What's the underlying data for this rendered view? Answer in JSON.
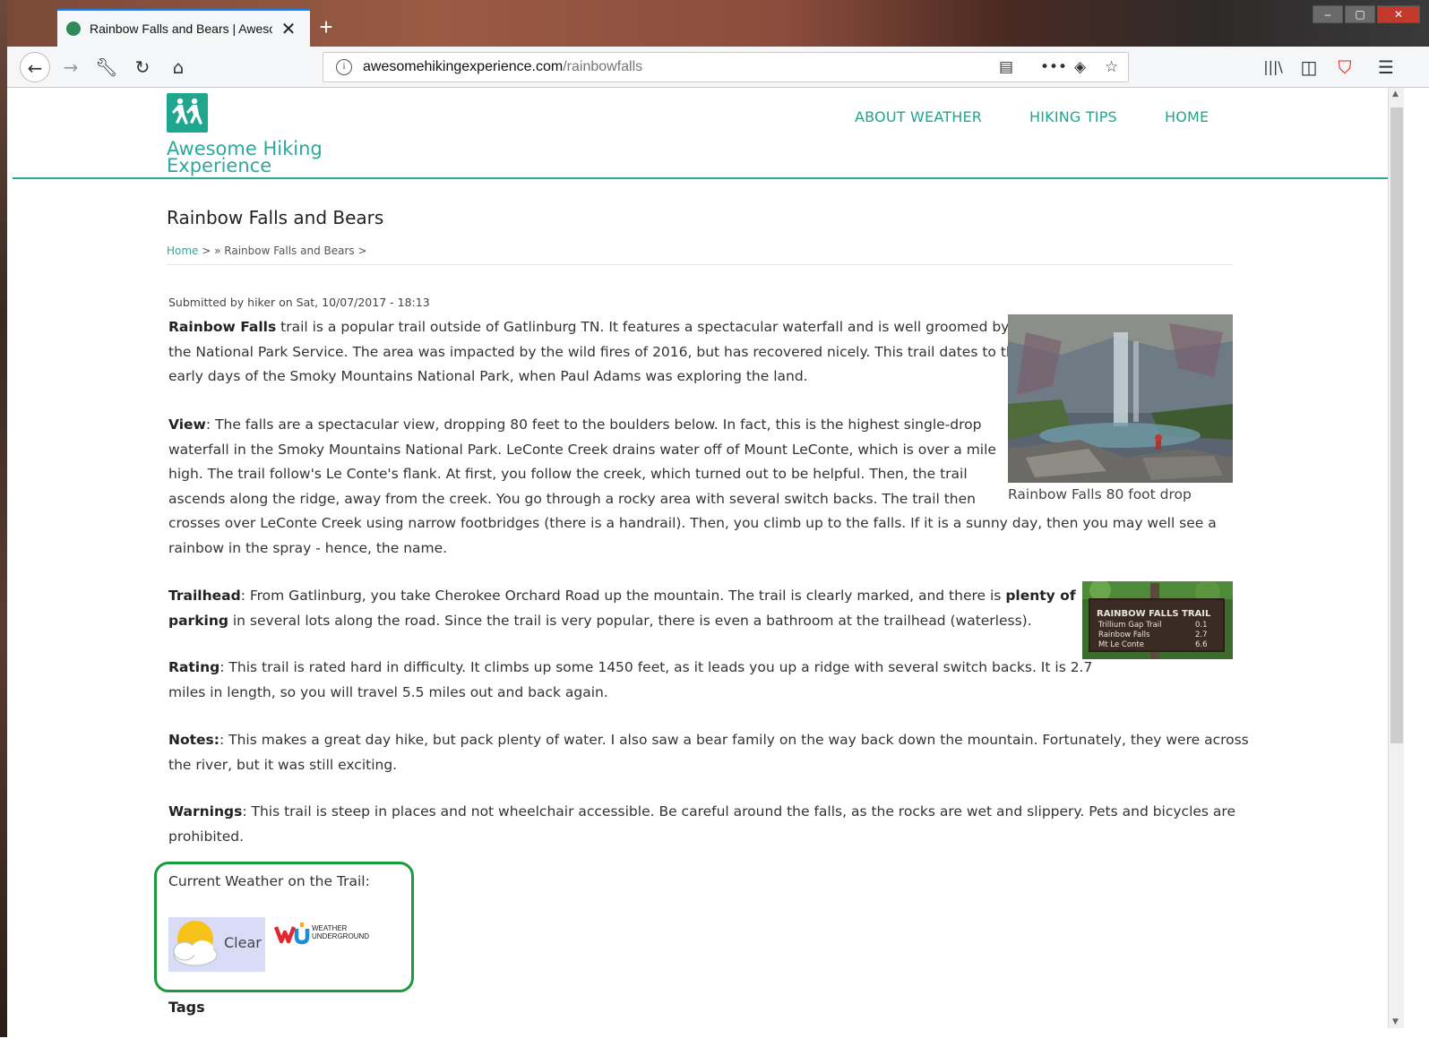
{
  "browser": {
    "tab_title": "Rainbow Falls and Bears | Awesome Hiking Experience",
    "url_host": "awesomehikingexperience.com",
    "url_path": "/rainbowfalls"
  },
  "site": {
    "logo_text": "Awesome Hiking Experience",
    "nav": [
      "ABOUT WEATHER",
      "HIKING TIPS",
      "HOME"
    ]
  },
  "page": {
    "title": "Rainbow Falls and Bears",
    "breadcrumb_home": "Home",
    "breadcrumb_rest": " > » Rainbow Falls and Bears >",
    "submitted": "Submitted by hiker on Sat, 10/07/2017 - 18:13"
  },
  "article": {
    "p1_strong": "Rainbow Falls",
    "p1_lines": [
      " trail is a popular trail outside of Gatlinburg TN. It features a spectacular waterfall and is well groomed by",
      "the National Park Service. The area was impacted by the wild fires of 2016, but has recovered nicely. This trail dates to the",
      "early days of the Smoky Mountains National Park, when Paul Adams was exploring the land."
    ],
    "p2_strong": "View",
    "p2_lines": [
      ": The falls are a spectacular view, dropping 80 feet to the boulders below. In fact, this is the highest single-drop",
      "waterfall in the Smoky Mountains National Park. LeConte Creek drains water off of Mount LeConte, which is over a mile",
      "high. The trail follow's Le Conte's flank. At first, you follow the creek, which turned out to be helpful. Then, the trail",
      "ascends along the ridge, away from the creek. You go through a rocky area with several switch backs. The trail then",
      "crosses over LeConte Creek using narrow footbridges (there is a handrail). Then, you climb up to the falls. If it is a sunny day, then you may well see a",
      "rainbow in the spray - hence, the name."
    ],
    "p3_strong": "Trailhead",
    "p3_line1_a": ": From Gatlinburg, you take Cherokee Orchard Road up the mountain. The trail is clearly marked, and there is ",
    "p3_strong2a": "plenty of",
    "p3_strong2b": "parking",
    "p3_line2_b": " in several lots along the road. Since the trail is very popular, there is even a bathroom at the trailhead (waterless).",
    "p4_strong": "Rating",
    "p4_lines": [
      ": This trail is rated hard in difficulty. It climbs up some 1450 feet, as it leads you up a ridge with several switch backs. It is 2.7",
      "miles in length, so you will travel 5.5 miles out and back again."
    ],
    "p5_strong": "Notes:",
    "p5_lines": [
      ": This makes a great day hike, but pack plenty of water. I also saw a bear family on the way back down the mountain. Fortunately, they were across",
      "the river, but it was still exciting."
    ],
    "p6_strong": "Warnings",
    "p6_lines": [
      ": This trail is steep in places and not wheelchair accessible. Be careful around the falls, as the rocks are wet and slippery. Pets and bicycles are",
      "prohibited."
    ],
    "falls_caption": "Rainbow Falls 80 foot drop"
  },
  "sign": {
    "title": "RAINBOW FALLS TRAIL",
    "rows": [
      {
        "name": "Trillium Gap Trail",
        "dist": "0.1"
      },
      {
        "name": "Rainbow Falls",
        "dist": "2.7"
      },
      {
        "name": "Mt Le Conte",
        "dist": "6.6"
      }
    ]
  },
  "weather": {
    "label": "Current Weather on the Trail:",
    "condition": "Clear",
    "wu_line1": "WEATHER",
    "wu_line2": "UNDERGROUND"
  },
  "tags_heading": "Tags",
  "colors": {
    "accent": "#1fa68e",
    "highlight_border": "#1a9a3a"
  }
}
